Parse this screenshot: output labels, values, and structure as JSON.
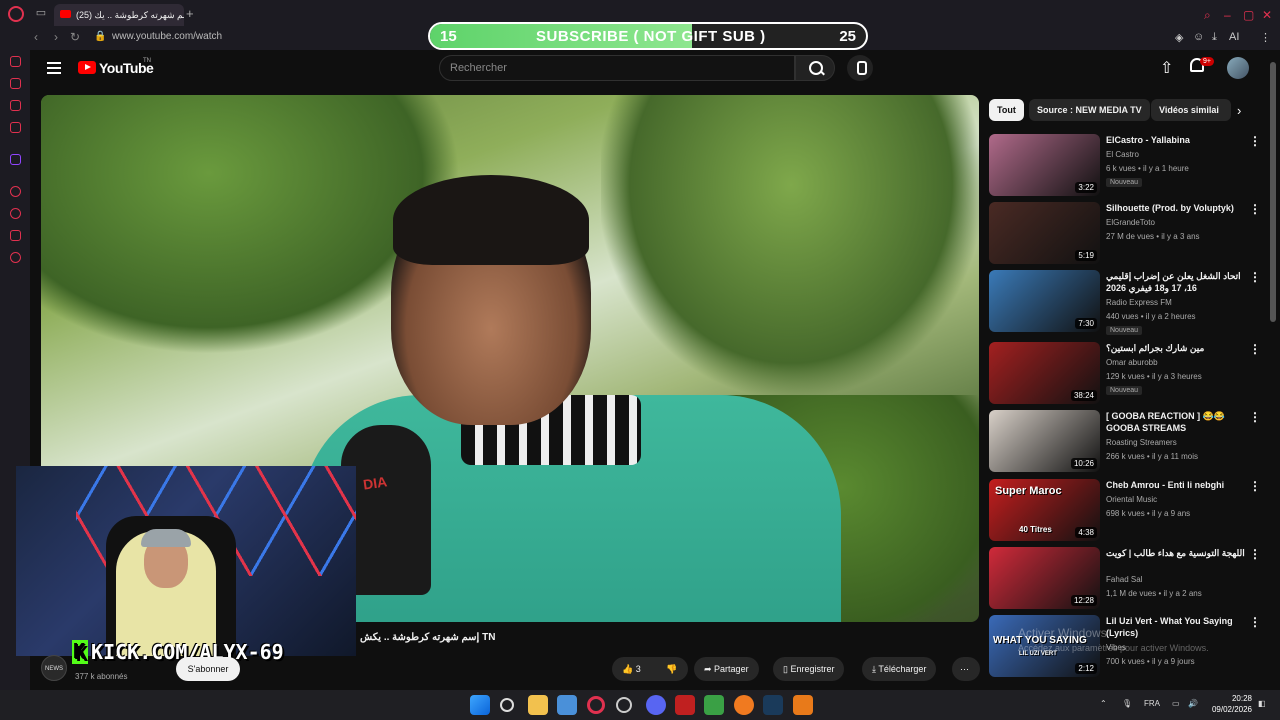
{
  "browser": {
    "tab_title": "(25) إسم شهرته كرطوشة .. يك",
    "url": "www.youtube.com/watch"
  },
  "overlay": {
    "left_count": "15",
    "right_count": "25",
    "progress_fraction": 0.6,
    "text": "SUBSCRIBE ( NOT GIFT SUB )",
    "kick_k": "K",
    "kick_text": "KICK.COM/ALYX-69"
  },
  "header": {
    "logo": "YouTube",
    "logo_sup": "TN",
    "search_placeholder": "Rechercher",
    "notif_badge": "9+"
  },
  "video": {
    "title": "إسم شهرته كرطوشة .. يكش TN",
    "mic_label": "DIA",
    "channel_avatar_text": "NEWS",
    "subscribers": "377 k abonnés",
    "subscribe_label": "S'abonner",
    "likes": "3",
    "share": "Partager",
    "save": "Enregistrer",
    "download": "Télécharger"
  },
  "chips": [
    "Tout",
    "Source : NEW MEDIA TV",
    "Vidéos similai"
  ],
  "recommendations": [
    {
      "title": "ElCastro - Yallabina",
      "channel": "El Castro",
      "meta": "6 k vues • il y a 1 heure",
      "duration": "3:22",
      "badge": "Nouveau",
      "color": "#b06a8a"
    },
    {
      "title": "Silhouette (Prod. by Voluptyk)",
      "channel": "ElGrandeToto",
      "meta": "27 M de vues • il y a 3 ans",
      "duration": "5:19",
      "badge": "",
      "color": "#4a2a24"
    },
    {
      "title": "اتحاد الشغل يعلن عن إضراب إقليمي 16، 17 و18 فيفري 2026",
      "channel": "Radio Express FM",
      "meta": "440 vues • il y a 2 heures",
      "duration": "7:30",
      "badge": "Nouveau",
      "color": "#3a7ab8"
    },
    {
      "title": "مين شارك بجرائم ابستين؟",
      "channel": "Omar aburobb",
      "meta": "129 k vues • il y a 3 heures",
      "duration": "38:24",
      "badge": "Nouveau",
      "color": "#a32020"
    },
    {
      "title": "[ GOOBA REACTION ] 😂😂 GOOBA STREAMS HIGHLIGHT…",
      "channel": "Roasting Streamers",
      "meta": "266 k vues • il y a 11 mois",
      "duration": "10:26",
      "badge": "",
      "color": "#d8d0c8"
    },
    {
      "title": "Cheb Amrou - Enti li nebghi",
      "channel": "Oriental Music",
      "meta": "698 k vues • il y a 9 ans",
      "duration": "4:38",
      "badge": "",
      "color": "#c41e1e"
    },
    {
      "title": "اللهجة التونسية مع هداء طالب | كويت",
      "channel": "Fahad Sal",
      "meta": "1,1 M de vues • il y a 2 ans",
      "duration": "12:28",
      "badge": "",
      "color": "#d02a3a"
    },
    {
      "title": "Lil Uzi Vert - What You Saying (Lyrics)",
      "channel": "Vibes",
      "meta": "700 k vues • il y a 9 jours",
      "duration": "2:12",
      "badge": "",
      "color": "#3a6ab8"
    }
  ],
  "thumb_labels": {
    "super": "Super Maroc",
    "titres": "40 Titres",
    "what": "WHAT YOU SAYING",
    "uzi": "LIL UZI VERT"
  },
  "watermark": {
    "line1": "Activer Windows",
    "line2": "Accédez aux paramètres pour activer Windows."
  },
  "taskbar": {
    "lang": "FRA",
    "time": "20:28",
    "date": "09/02/2026"
  },
  "extensions": {
    "ai": "AI"
  }
}
